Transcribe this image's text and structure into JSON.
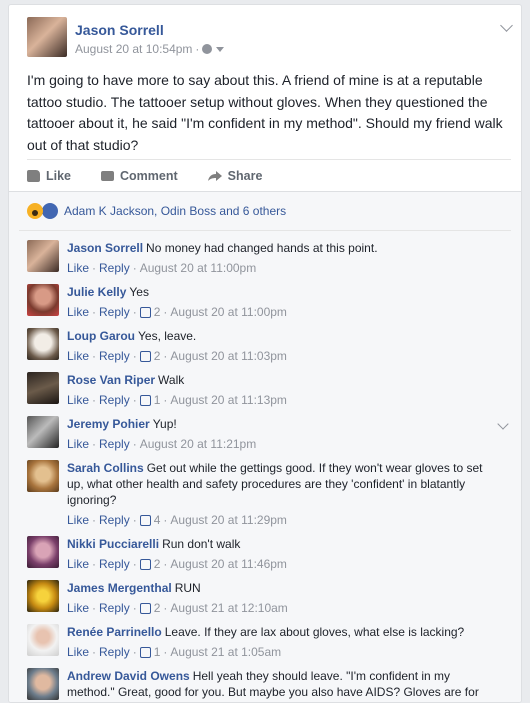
{
  "post": {
    "author": "Jason Sorrell",
    "timestamp": "August 20 at 10:54pm",
    "text": "I'm going to have more to say about this. A friend of mine is at a reputable tattoo studio. The tattooer setup without gloves. When they questioned the tattooer about it, he said \"I'm confident in my method\". Should my friend walk out of that studio?",
    "actions": {
      "like": "Like",
      "comment": "Comment",
      "share": "Share"
    }
  },
  "reactions": {
    "summary": "Adam K Jackson, Odin Boss and 6 others"
  },
  "comments": [
    {
      "name": "Jason Sorrell",
      "text": "No money had changed hands at this point.",
      "like": "Like",
      "reply": "Reply",
      "likes": "",
      "time": "August 20 at 11:00pm"
    },
    {
      "name": "Julie Kelly",
      "text": "Yes",
      "like": "Like",
      "reply": "Reply",
      "likes": "2",
      "time": "August 20 at 11:00pm"
    },
    {
      "name": "Loup Garou",
      "text": "Yes, leave.",
      "like": "Like",
      "reply": "Reply",
      "likes": "2",
      "time": "August 20 at 11:03pm"
    },
    {
      "name": "Rose Van Riper",
      "text": "Walk",
      "like": "Like",
      "reply": "Reply",
      "likes": "1",
      "time": "August 20 at 11:13pm"
    },
    {
      "name": "Jeremy Pohier",
      "text": "Yup!",
      "like": "Like",
      "reply": "Reply",
      "likes": "",
      "time": "August 20 at 11:21pm"
    },
    {
      "name": "Sarah Collins",
      "text": "Get out while the gettings good. If they won't wear gloves to set up, what other health and safety procedures are they 'confident' in blatantly ignoring?",
      "like": "Like",
      "reply": "Reply",
      "likes": "4",
      "time": "August 20 at 11:29pm"
    },
    {
      "name": "Nikki Pucciarelli",
      "text": "Run don't walk",
      "like": "Like",
      "reply": "Reply",
      "likes": "2",
      "time": "August 20 at 11:46pm"
    },
    {
      "name": "James Mergenthal",
      "text": "RUN",
      "like": "Like",
      "reply": "Reply",
      "likes": "2",
      "time": "August 21 at 12:10am"
    },
    {
      "name": "Renée Parrinello",
      "text": "Leave. If they are lax about gloves, what else is lacking?",
      "like": "Like",
      "reply": "Reply",
      "likes": "1",
      "time": "August 21 at 1:05am"
    },
    {
      "name": "Andrew David Owens",
      "text": "Hell yeah they should leave. \"I'm confident in my method.\" Great, good for you. But maybe you also have AIDS? Gloves are for",
      "like": "Like",
      "reply": "Reply",
      "likes": "",
      "time": ""
    }
  ],
  "colors": {
    "link": "#365899",
    "meta": "#90949c",
    "background": "#e9ebee"
  }
}
